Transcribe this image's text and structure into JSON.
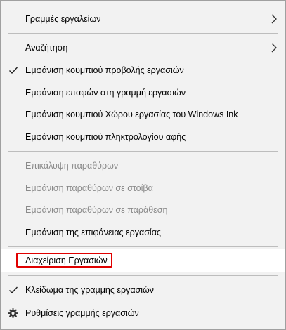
{
  "menu": {
    "items": [
      {
        "label": "Γραμμές εργαλείων",
        "submenu": true
      },
      {
        "label": "Αναζήτηση",
        "submenu": true
      },
      {
        "label": "Εμφάνιση κουμπιού προβολής εργασιών",
        "checked": true
      },
      {
        "label": "Εμφάνιση επαφών στη γραμμή εργασιών"
      },
      {
        "label": "Εμφάνιση κουμπιού Χώρου εργασίας του Windows Ink"
      },
      {
        "label": "Εμφάνιση κουμπιού πληκτρολογίου αφής"
      },
      {
        "label": "Επικάλυψη παραθύρων",
        "disabled": true
      },
      {
        "label": "Εμφάνιση παραθύρων σε στοίβα",
        "disabled": true
      },
      {
        "label": "Εμφάνιση παραθύρων σε παράθεση",
        "disabled": true
      },
      {
        "label": "Εμφάνιση της επιφάνειας εργασίας"
      },
      {
        "label": "Διαχείριση Εργασιών",
        "highlighted": true
      },
      {
        "label": "Κλείδωμα της γραμμής εργασιών",
        "checked": true
      },
      {
        "label": "Ρυθμίσεις γραμμής εργασιών",
        "icon": "gear-icon"
      }
    ]
  },
  "colors": {
    "menu_background": "#f2f2f2",
    "highlight_background": "#ffffff",
    "annotation_box": "#e00000",
    "disabled_text": "#8a8a8a",
    "separator": "#bdbdbd"
  }
}
